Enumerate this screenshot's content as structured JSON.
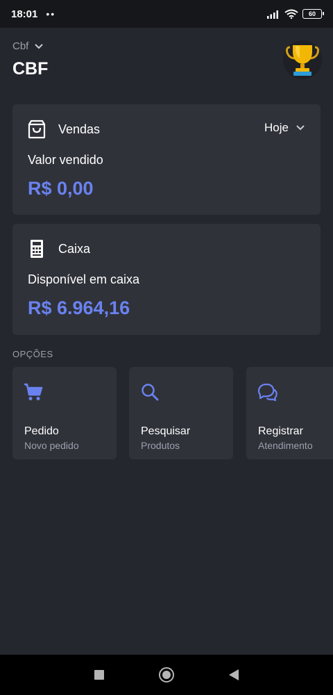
{
  "status": {
    "time": "18:01",
    "dots": "••",
    "battery": "60"
  },
  "header": {
    "company_select": "Cbf",
    "company_name": "CBF"
  },
  "sales_card": {
    "title": "Vendas",
    "period": "Hoje",
    "label": "Valor vendido",
    "value": "R$ 0,00"
  },
  "cash_card": {
    "title": "Caixa",
    "label": "Disponível em caixa",
    "value": "R$ 6.964,16"
  },
  "options": {
    "section_label": "OPÇÕES",
    "items": [
      {
        "title": "Pedido",
        "subtitle": "Novo pedido",
        "icon": "cart-icon"
      },
      {
        "title": "Pesquisar",
        "subtitle": "Produtos",
        "icon": "search-icon"
      },
      {
        "title": "Registrar",
        "subtitle": "Atendimento",
        "icon": "chat-icon"
      }
    ]
  },
  "colors": {
    "accent": "#6a82f0",
    "background": "#25272e",
    "card": "#30323a",
    "muted": "#9aa0ab"
  }
}
